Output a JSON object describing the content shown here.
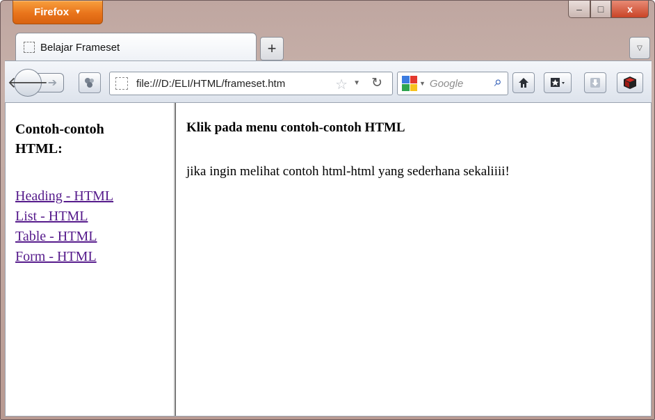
{
  "browser": {
    "menu_button": "Firefox",
    "tab_title": "Belajar Frameset",
    "new_tab": "+",
    "url": "file:///D:/ELI/HTML/frameset.htm",
    "search_placeholder": "Google",
    "window_controls": {
      "minimize": "–",
      "maximize": "□",
      "close": "x"
    }
  },
  "left_frame": {
    "title": "Contoh-contoh HTML:",
    "links": [
      "Heading - HTML",
      "List - HTML",
      "Table - HTML",
      "Form - HTML"
    ]
  },
  "right_frame": {
    "heading": "Klik pada menu contoh-contoh HTML",
    "text": "jika ingin melihat contoh html-html yang sederhana sekaliiii!"
  },
  "colors": {
    "visited_link": "#551a8b",
    "firefox_orange": "#e9741b",
    "close_red": "#c94427"
  }
}
